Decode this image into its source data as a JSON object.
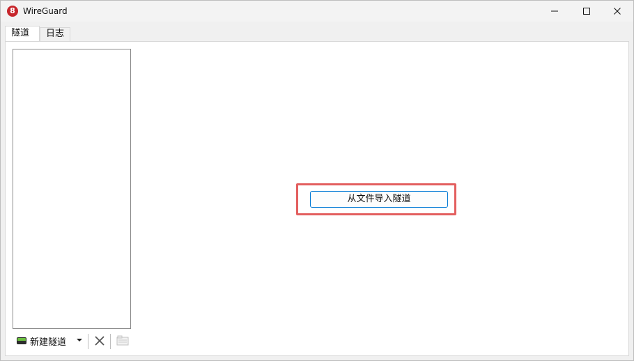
{
  "window": {
    "title": "WireGuard",
    "app_icon_text": "8"
  },
  "tabs": [
    {
      "label": "隧道",
      "selected": true
    },
    {
      "label": "日志",
      "selected": false
    }
  ],
  "toolbar": {
    "add_tunnel_label": "新建隧道"
  },
  "main": {
    "import_button_label": "从文件导入隧道"
  },
  "colors": {
    "accent": "#0078d4",
    "highlight": "#e35f5f",
    "wireguard_red": "#c7262c"
  },
  "icons": {
    "minimize": "minimize-icon",
    "maximize": "maximize-icon",
    "close": "close-icon",
    "delete": "delete-icon",
    "export": "export-icon",
    "add": "add-tunnel-icon"
  }
}
